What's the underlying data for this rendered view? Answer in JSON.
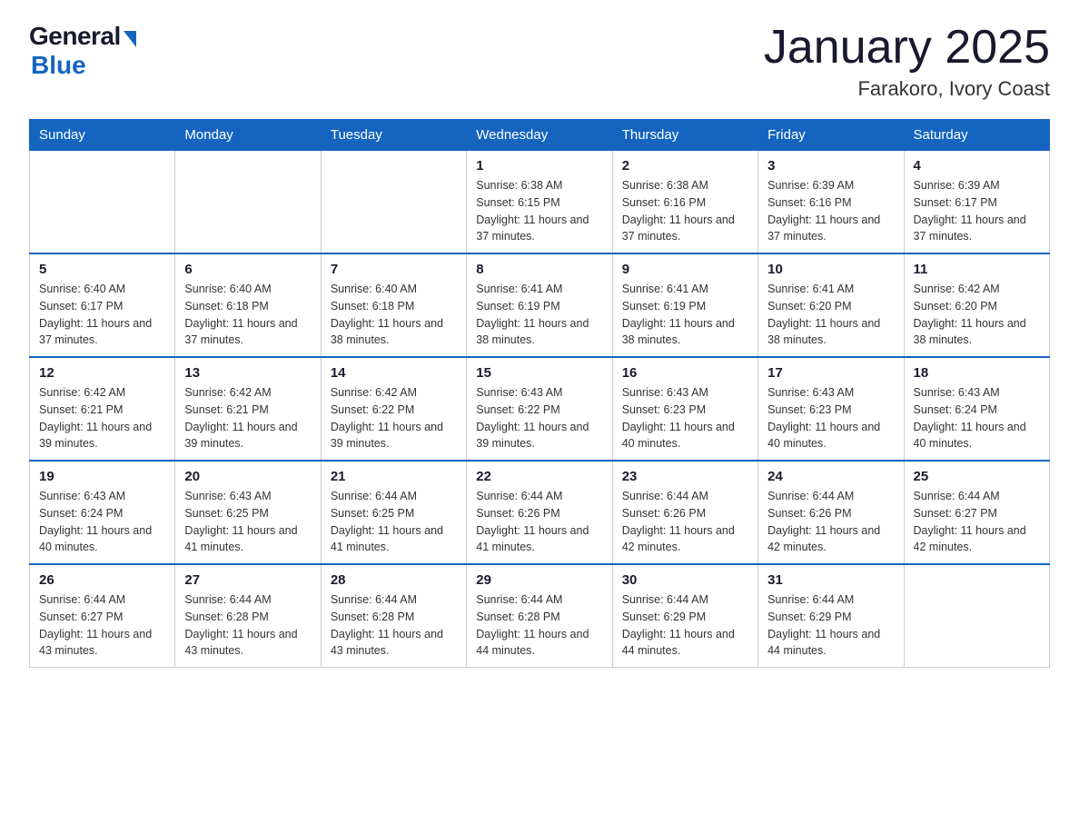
{
  "header": {
    "logo_general": "General",
    "logo_blue": "Blue",
    "title": "January 2025",
    "location": "Farakoro, Ivory Coast"
  },
  "days_of_week": [
    "Sunday",
    "Monday",
    "Tuesday",
    "Wednesday",
    "Thursday",
    "Friday",
    "Saturday"
  ],
  "weeks": [
    [
      {
        "day": "",
        "info": ""
      },
      {
        "day": "",
        "info": ""
      },
      {
        "day": "",
        "info": ""
      },
      {
        "day": "1",
        "info": "Sunrise: 6:38 AM\nSunset: 6:15 PM\nDaylight: 11 hours and 37 minutes."
      },
      {
        "day": "2",
        "info": "Sunrise: 6:38 AM\nSunset: 6:16 PM\nDaylight: 11 hours and 37 minutes."
      },
      {
        "day": "3",
        "info": "Sunrise: 6:39 AM\nSunset: 6:16 PM\nDaylight: 11 hours and 37 minutes."
      },
      {
        "day": "4",
        "info": "Sunrise: 6:39 AM\nSunset: 6:17 PM\nDaylight: 11 hours and 37 minutes."
      }
    ],
    [
      {
        "day": "5",
        "info": "Sunrise: 6:40 AM\nSunset: 6:17 PM\nDaylight: 11 hours and 37 minutes."
      },
      {
        "day": "6",
        "info": "Sunrise: 6:40 AM\nSunset: 6:18 PM\nDaylight: 11 hours and 37 minutes."
      },
      {
        "day": "7",
        "info": "Sunrise: 6:40 AM\nSunset: 6:18 PM\nDaylight: 11 hours and 38 minutes."
      },
      {
        "day": "8",
        "info": "Sunrise: 6:41 AM\nSunset: 6:19 PM\nDaylight: 11 hours and 38 minutes."
      },
      {
        "day": "9",
        "info": "Sunrise: 6:41 AM\nSunset: 6:19 PM\nDaylight: 11 hours and 38 minutes."
      },
      {
        "day": "10",
        "info": "Sunrise: 6:41 AM\nSunset: 6:20 PM\nDaylight: 11 hours and 38 minutes."
      },
      {
        "day": "11",
        "info": "Sunrise: 6:42 AM\nSunset: 6:20 PM\nDaylight: 11 hours and 38 minutes."
      }
    ],
    [
      {
        "day": "12",
        "info": "Sunrise: 6:42 AM\nSunset: 6:21 PM\nDaylight: 11 hours and 39 minutes."
      },
      {
        "day": "13",
        "info": "Sunrise: 6:42 AM\nSunset: 6:21 PM\nDaylight: 11 hours and 39 minutes."
      },
      {
        "day": "14",
        "info": "Sunrise: 6:42 AM\nSunset: 6:22 PM\nDaylight: 11 hours and 39 minutes."
      },
      {
        "day": "15",
        "info": "Sunrise: 6:43 AM\nSunset: 6:22 PM\nDaylight: 11 hours and 39 minutes."
      },
      {
        "day": "16",
        "info": "Sunrise: 6:43 AM\nSunset: 6:23 PM\nDaylight: 11 hours and 40 minutes."
      },
      {
        "day": "17",
        "info": "Sunrise: 6:43 AM\nSunset: 6:23 PM\nDaylight: 11 hours and 40 minutes."
      },
      {
        "day": "18",
        "info": "Sunrise: 6:43 AM\nSunset: 6:24 PM\nDaylight: 11 hours and 40 minutes."
      }
    ],
    [
      {
        "day": "19",
        "info": "Sunrise: 6:43 AM\nSunset: 6:24 PM\nDaylight: 11 hours and 40 minutes."
      },
      {
        "day": "20",
        "info": "Sunrise: 6:43 AM\nSunset: 6:25 PM\nDaylight: 11 hours and 41 minutes."
      },
      {
        "day": "21",
        "info": "Sunrise: 6:44 AM\nSunset: 6:25 PM\nDaylight: 11 hours and 41 minutes."
      },
      {
        "day": "22",
        "info": "Sunrise: 6:44 AM\nSunset: 6:26 PM\nDaylight: 11 hours and 41 minutes."
      },
      {
        "day": "23",
        "info": "Sunrise: 6:44 AM\nSunset: 6:26 PM\nDaylight: 11 hours and 42 minutes."
      },
      {
        "day": "24",
        "info": "Sunrise: 6:44 AM\nSunset: 6:26 PM\nDaylight: 11 hours and 42 minutes."
      },
      {
        "day": "25",
        "info": "Sunrise: 6:44 AM\nSunset: 6:27 PM\nDaylight: 11 hours and 42 minutes."
      }
    ],
    [
      {
        "day": "26",
        "info": "Sunrise: 6:44 AM\nSunset: 6:27 PM\nDaylight: 11 hours and 43 minutes."
      },
      {
        "day": "27",
        "info": "Sunrise: 6:44 AM\nSunset: 6:28 PM\nDaylight: 11 hours and 43 minutes."
      },
      {
        "day": "28",
        "info": "Sunrise: 6:44 AM\nSunset: 6:28 PM\nDaylight: 11 hours and 43 minutes."
      },
      {
        "day": "29",
        "info": "Sunrise: 6:44 AM\nSunset: 6:28 PM\nDaylight: 11 hours and 44 minutes."
      },
      {
        "day": "30",
        "info": "Sunrise: 6:44 AM\nSunset: 6:29 PM\nDaylight: 11 hours and 44 minutes."
      },
      {
        "day": "31",
        "info": "Sunrise: 6:44 AM\nSunset: 6:29 PM\nDaylight: 11 hours and 44 minutes."
      },
      {
        "day": "",
        "info": ""
      }
    ]
  ]
}
